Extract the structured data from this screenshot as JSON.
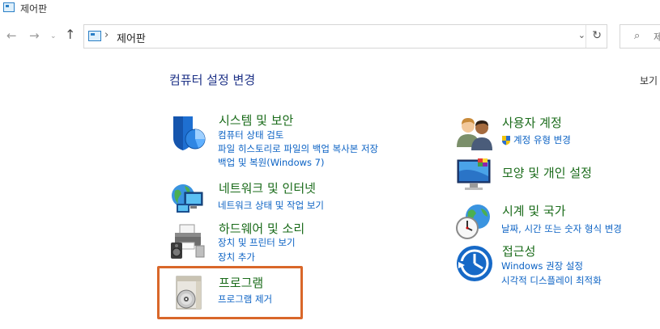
{
  "window": {
    "title": "제어판"
  },
  "address": {
    "path": "제어판",
    "separator": "›"
  },
  "nav": {
    "back": "←",
    "forward": "→",
    "recent": "⌄",
    "up": "↑",
    "dropdown": "⌄",
    "refresh": "↻"
  },
  "search": {
    "placeholder": "제",
    "icon": "⌕"
  },
  "main": {
    "heading": "컴퓨터 설정 변경",
    "view_by": "보기"
  },
  "left_categories": [
    {
      "title": "시스템 및 보안",
      "icon": "shield-icon",
      "links": [
        "컴퓨터 상태 검토",
        "파일 히스토리로 파일의 백업 복사본 저장",
        "백업 및 복원(Windows 7)"
      ]
    },
    {
      "title": "네트워크 및 인터넷",
      "icon": "network-globe-icon",
      "links": [
        "네트워크 상태 및 작업 보기"
      ]
    },
    {
      "title": "하드웨어 및 소리",
      "icon": "printer-speaker-icon",
      "links": [
        "장치 및 프린터 보기",
        "장치 추가"
      ]
    },
    {
      "title": "프로그램",
      "icon": "program-disc-icon",
      "links": [
        "프로그램 제거"
      ]
    }
  ],
  "right_categories": [
    {
      "title": "사용자 계정",
      "icon": "users-icon",
      "links": [
        "계정 유형 변경"
      ]
    },
    {
      "title": "모양 및 개인 설정",
      "icon": "monitor-palette-icon",
      "links": []
    },
    {
      "title": "시계 및 국가",
      "icon": "clock-globe-icon",
      "links": [
        "날짜, 시간 또는 숫자 형식 변경"
      ]
    },
    {
      "title": "접근성",
      "icon": "ease-of-access-icon",
      "links": [
        "Windows 권장 설정",
        "시각적 디스플레이 최적화"
      ]
    }
  ],
  "colors": {
    "category_title": "#1a6b1a",
    "link": "#0b62c4",
    "heading": "#1e3287",
    "highlight": "#d9672a"
  }
}
